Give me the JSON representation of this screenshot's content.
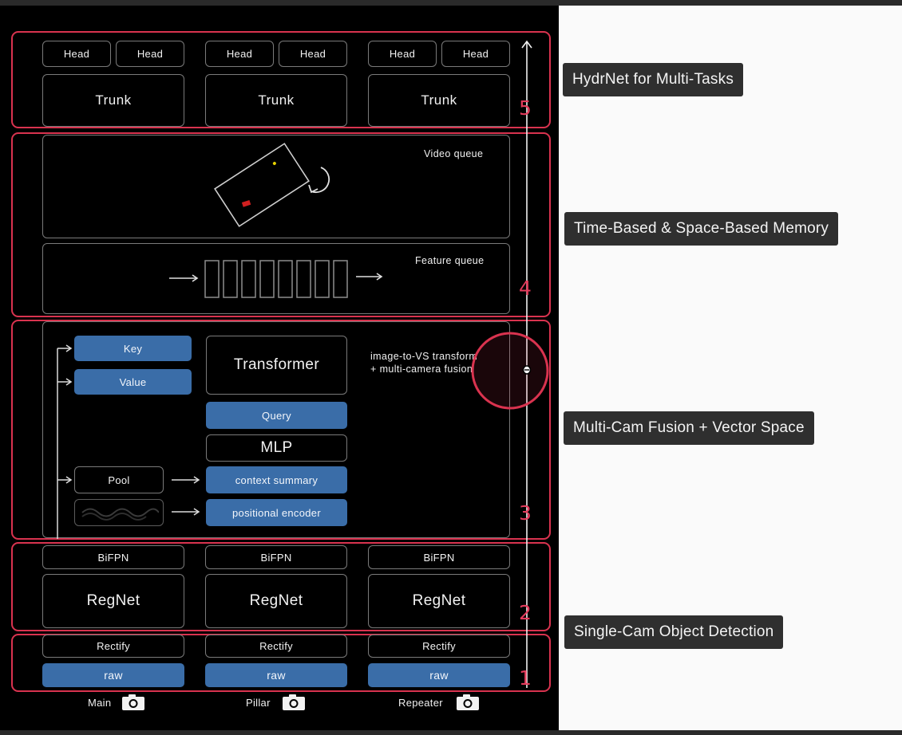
{
  "sections": {
    "hydranet": {
      "heads": [
        "Head",
        "Head",
        "Head",
        "Head",
        "Head",
        "Head"
      ],
      "trunks": [
        "Trunk",
        "Trunk",
        "Trunk"
      ],
      "number": "5"
    },
    "memory": {
      "video_queue_label": "Video queue",
      "feature_queue_label": "Feature queue",
      "number": "4"
    },
    "fusion": {
      "key": "Key",
      "value": "Value",
      "transformer": "Transformer",
      "query": "Query",
      "mlp": "MLP",
      "pool": "Pool",
      "context_summary": "context summary",
      "positional_encoder": "positional encoder",
      "note_line1": "image-to-VS transform",
      "note_line2": "+ multi-camera fusion",
      "number": "3"
    },
    "backbone": {
      "bifpn": [
        "BiFPN",
        "BiFPN",
        "BiFPN"
      ],
      "regnet": [
        "RegNet",
        "RegNet",
        "RegNet"
      ],
      "number": "2"
    },
    "input": {
      "rectify": [
        "Rectify",
        "Rectify",
        "Rectify"
      ],
      "raw": [
        "raw",
        "raw",
        "raw"
      ],
      "number": "1"
    }
  },
  "cameras": [
    {
      "label": "Main",
      "icon": "camera-icon"
    },
    {
      "label": "Pillar",
      "icon": "camera-icon"
    },
    {
      "label": "Repeater",
      "icon": "camera-icon"
    }
  ],
  "annotations": [
    "HydrNet for Multi-Tasks",
    "Time-Based & Space-Based Memory",
    "Multi-Cam Fusion + Vector Space",
    "Single-Cam Object Detection"
  ],
  "colors": {
    "section_border": "#d9334f",
    "blue_box": "#3a6da8",
    "number": "#e43b5c",
    "panel_bg": "#000000"
  }
}
